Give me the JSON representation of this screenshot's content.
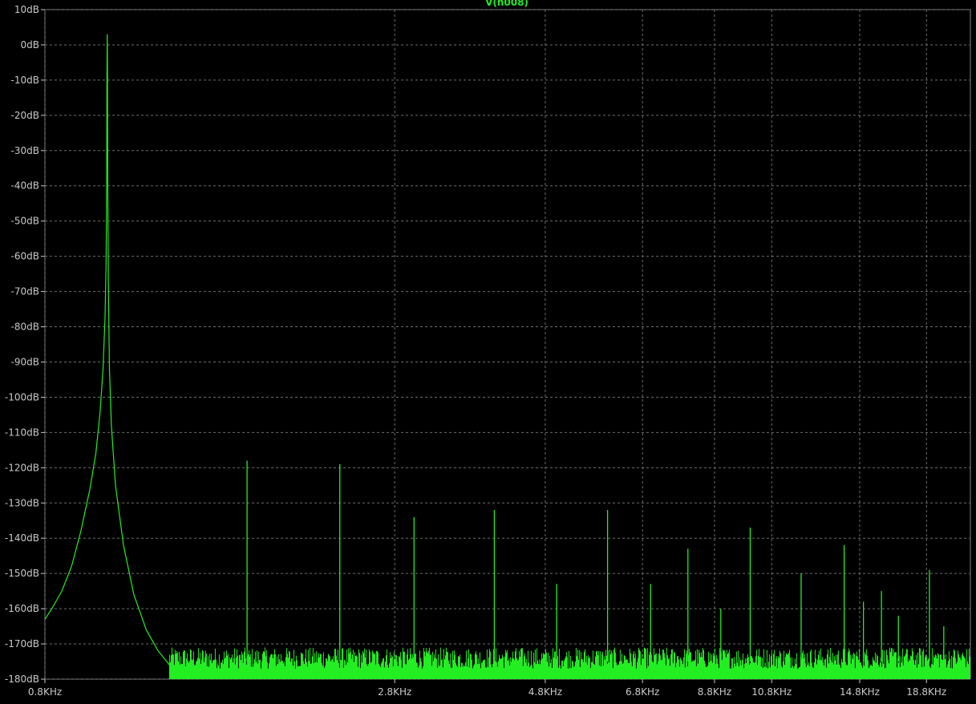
{
  "chart_data": {
    "type": "line",
    "title": "V(n008)",
    "xlabel": "",
    "ylabel": "",
    "x_scale": "log",
    "x_unit": "Hz",
    "xlim": [
      800,
      22000
    ],
    "ylim": [
      -180,
      10
    ],
    "grid": true,
    "x_ticks": [
      800,
      2800,
      4800,
      6800,
      8800,
      10800,
      14800,
      18800
    ],
    "x_tick_labels": [
      "0.8KHz",
      "2.8KHz",
      "4.8KHz",
      "6.8KHz",
      "8.8KHz",
      "10.8KHz",
      "14.8KHz",
      "18.8KHz"
    ],
    "y_ticks": [
      10,
      0,
      -10,
      -20,
      -30,
      -40,
      -50,
      -60,
      -70,
      -80,
      -90,
      -100,
      -110,
      -120,
      -130,
      -140,
      -150,
      -160,
      -170,
      -180
    ],
    "y_tick_labels": [
      "10dB",
      "0dB",
      "-10dB",
      "-20dB",
      "-30dB",
      "-40dB",
      "-50dB",
      "-60dB",
      "-70dB",
      "-80dB",
      "-90dB",
      "-100dB",
      "-110dB",
      "-120dB",
      "-130dB",
      "-140dB",
      "-150dB",
      "-160dB",
      "-170dB",
      "-180dB"
    ],
    "noise_floor_db": -175,
    "series": [
      {
        "name": "V(n008)",
        "color": "#22ee22",
        "fundamental": {
          "freq": 1000,
          "db": 3
        },
        "peak_shape": [
          [
            800,
            -163
          ],
          [
            820,
            -160
          ],
          [
            850,
            -155
          ],
          [
            880,
            -148
          ],
          [
            910,
            -138
          ],
          [
            940,
            -126
          ],
          [
            960,
            -116
          ],
          [
            975,
            -104
          ],
          [
            985,
            -92
          ],
          [
            992,
            -78
          ],
          [
            996,
            -62
          ],
          [
            998,
            -40
          ],
          [
            999,
            -10
          ],
          [
            1000,
            3
          ],
          [
            1001,
            -8
          ],
          [
            1002,
            -40
          ],
          [
            1004,
            -67
          ],
          [
            1008,
            -92
          ],
          [
            1015,
            -108
          ],
          [
            1030,
            -125
          ],
          [
            1060,
            -142
          ],
          [
            1100,
            -156
          ],
          [
            1150,
            -166
          ],
          [
            1200,
            -172
          ],
          [
            1250,
            -176
          ]
        ],
        "harmonics": [
          {
            "freq": 1650,
            "db": -118
          },
          {
            "freq": 2300,
            "db": -119
          },
          {
            "freq": 3000,
            "db": -134
          },
          {
            "freq": 4000,
            "db": -132
          },
          {
            "freq": 5000,
            "db": -153
          },
          {
            "freq": 6000,
            "db": -132
          },
          {
            "freq": 7000,
            "db": -153
          },
          {
            "freq": 8000,
            "db": -143
          },
          {
            "freq": 9000,
            "db": -160
          },
          {
            "freq": 10000,
            "db": -137
          },
          {
            "freq": 12000,
            "db": -150
          },
          {
            "freq": 14000,
            "db": -142
          },
          {
            "freq": 15000,
            "db": -158
          },
          {
            "freq": 16000,
            "db": -155
          },
          {
            "freq": 17000,
            "db": -162
          },
          {
            "freq": 19000,
            "db": -149
          },
          {
            "freq": 20000,
            "db": -165
          }
        ]
      }
    ]
  }
}
